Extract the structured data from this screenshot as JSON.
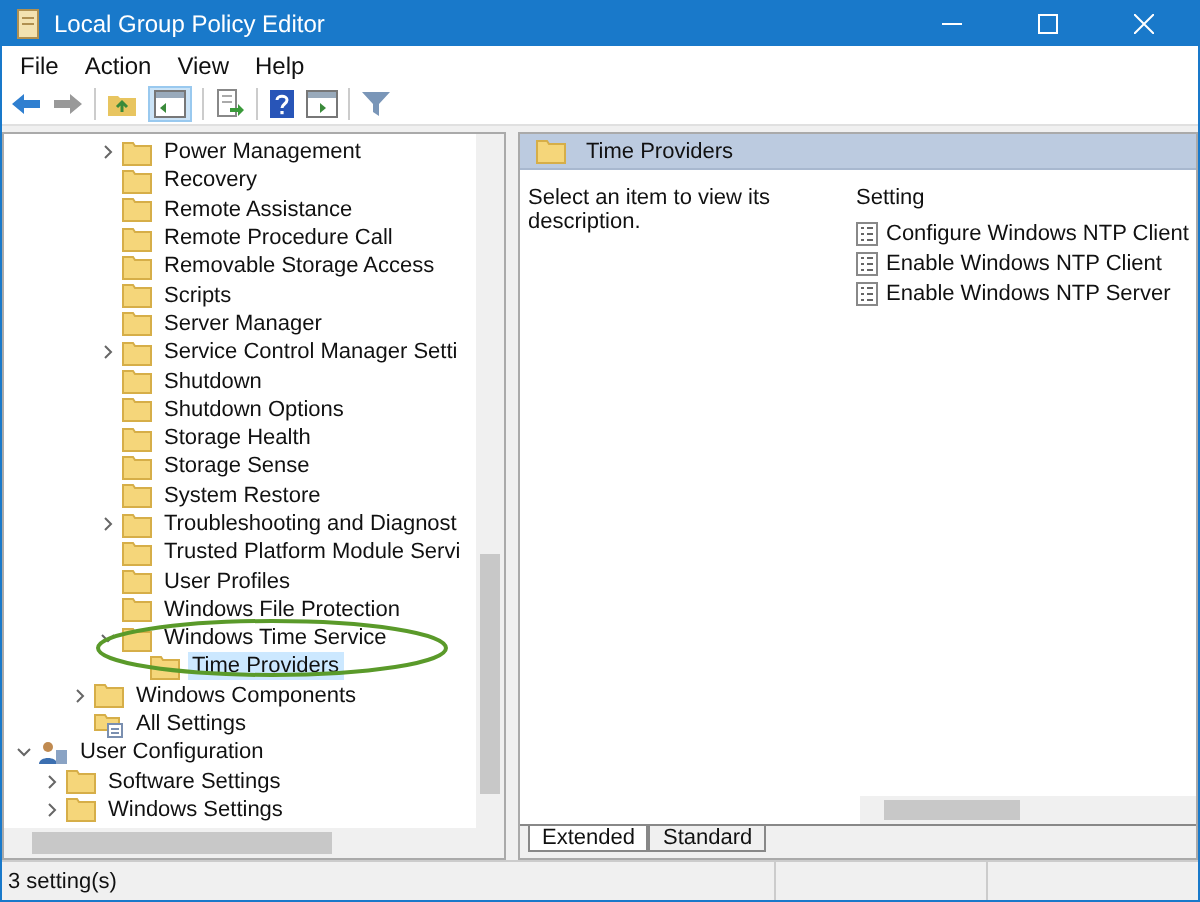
{
  "window": {
    "title": "Local Group Policy Editor"
  },
  "menu": [
    "File",
    "Action",
    "View",
    "Help"
  ],
  "toolbar": [
    {
      "kind": "back",
      "disabled": false
    },
    {
      "kind": "forward",
      "disabled": true
    },
    {
      "kind": "sep"
    },
    {
      "kind": "up"
    },
    {
      "kind": "tree",
      "pressed": true
    },
    {
      "kind": "sep"
    },
    {
      "kind": "export"
    },
    {
      "kind": "sep"
    },
    {
      "kind": "help"
    },
    {
      "kind": "pane"
    },
    {
      "kind": "sep"
    },
    {
      "kind": "filter"
    }
  ],
  "tree": [
    {
      "children": [
        {
          "children": [
            {
              "children": [
                {
                  "label": "Power Management",
                  "kind": "folder",
                  "expanded": false,
                  "selected": false
                },
                {
                  "label": "Recovery",
                  "kind": "folder",
                  "selected": false
                },
                {
                  "label": "Remote Assistance",
                  "kind": "folder",
                  "selected": false
                },
                {
                  "label": "Remote Procedure Call",
                  "kind": "folder",
                  "selected": false
                },
                {
                  "label": "Removable Storage Access",
                  "kind": "folder",
                  "selected": false
                },
                {
                  "label": "Scripts",
                  "kind": "folder",
                  "selected": false
                },
                {
                  "label": "Server Manager",
                  "kind": "folder",
                  "selected": false
                },
                {
                  "label": "Service Control Manager Setti",
                  "kind": "folder",
                  "expanded": false,
                  "selected": false
                },
                {
                  "label": "Shutdown",
                  "kind": "folder",
                  "selected": false
                },
                {
                  "label": "Shutdown Options",
                  "kind": "folder",
                  "selected": false
                },
                {
                  "label": "Storage Health",
                  "kind": "folder",
                  "selected": false
                },
                {
                  "label": "Storage Sense",
                  "kind": "folder",
                  "selected": false
                },
                {
                  "label": "System Restore",
                  "kind": "folder",
                  "selected": false
                },
                {
                  "label": "Troubleshooting and Diagnost",
                  "kind": "folder",
                  "expanded": false,
                  "selected": false
                },
                {
                  "label": "Trusted Platform Module Servi",
                  "kind": "folder",
                  "selected": false
                },
                {
                  "label": "User Profiles",
                  "kind": "folder",
                  "selected": false
                },
                {
                  "label": "Windows File Protection",
                  "kind": "folder",
                  "selected": false
                },
                {
                  "label": "Windows Time Service",
                  "kind": "folder",
                  "expanded": true,
                  "selected": false,
                  "children": [
                    {
                      "label": "Time Providers",
                      "kind": "folder",
                      "selected": true
                    }
                  ]
                }
              ]
            },
            {
              "label": "Windows Components",
              "kind": "folder",
              "expanded": false,
              "selected": false
            },
            {
              "label": "All Settings",
              "kind": "settings",
              "selected": false
            }
          ]
        }
      ]
    },
    {
      "label": "User Configuration",
      "kind": "user",
      "expanded": true,
      "selected": false,
      "children": [
        {
          "label": "Software Settings",
          "kind": "folder",
          "expanded": false,
          "selected": false
        },
        {
          "label": "Windows Settings",
          "kind": "folder",
          "expanded": false,
          "selected": false
        }
      ]
    }
  ],
  "details": {
    "title": "Time Providers",
    "description": "Select an item to view its description.",
    "column": "Setting",
    "settings": [
      "Configure Windows NTP Client",
      "Enable Windows NTP Client",
      "Enable Windows NTP Server"
    ]
  },
  "tabs": [
    {
      "label": "Extended",
      "selected": true
    },
    {
      "label": "Standard",
      "selected": false
    }
  ],
  "status_bar": "3 setting(s)"
}
